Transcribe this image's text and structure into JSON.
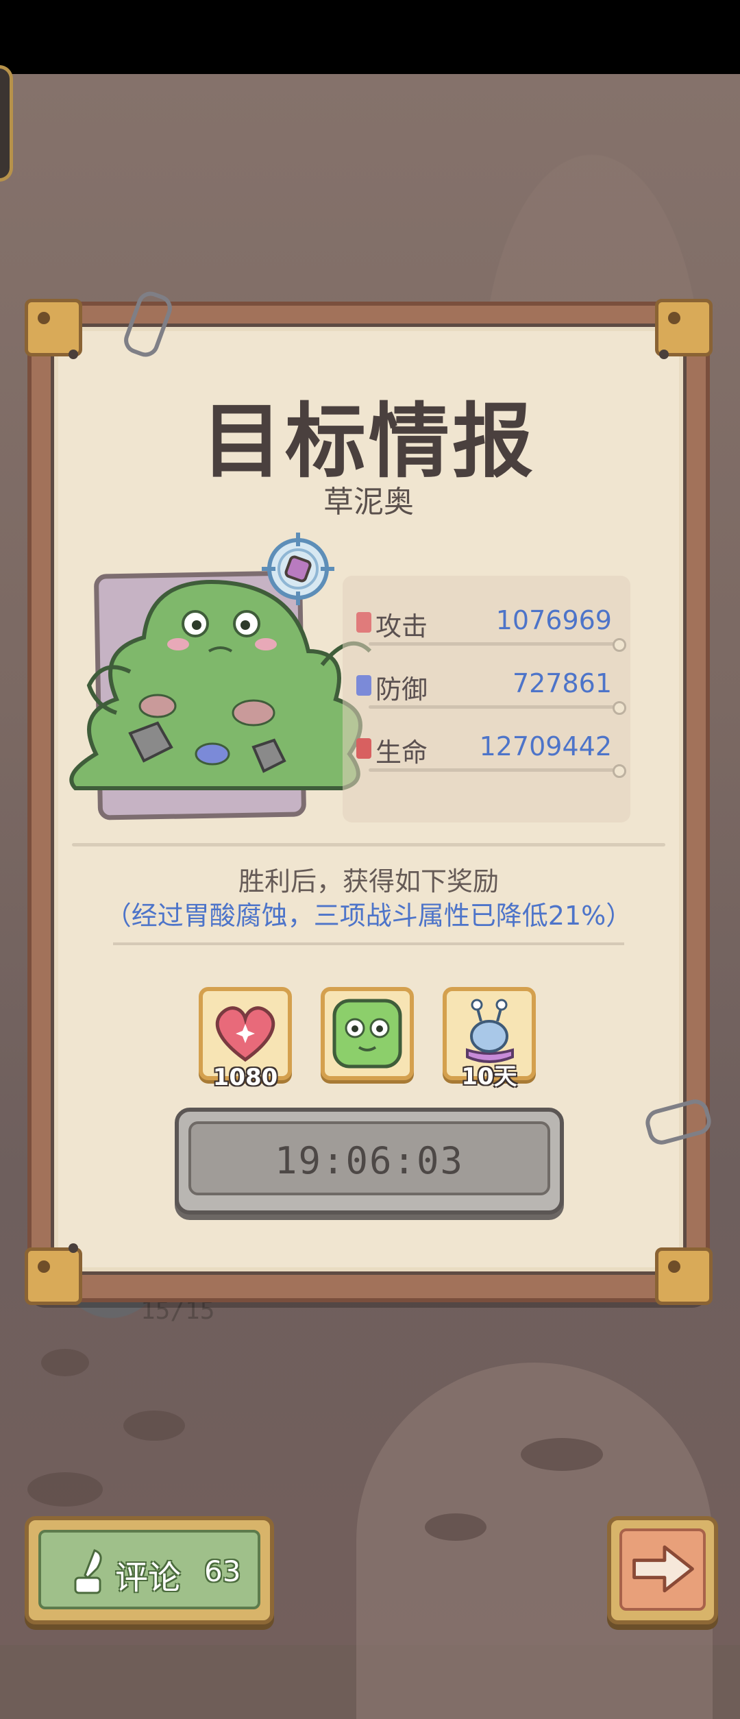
{
  "panel": {
    "title": "目标情报",
    "target_name": "草泥奥"
  },
  "stats": [
    {
      "label": "攻击",
      "value": "1076969",
      "icon": "sword-icon",
      "color": "#e07b7b"
    },
    {
      "label": "防御",
      "value": "727861",
      "icon": "shield-icon",
      "color": "#7b8ad8"
    },
    {
      "label": "生命",
      "value": "12709442",
      "icon": "health-icon",
      "color": "#d86060"
    }
  ],
  "reward": {
    "title": "胜利后，获得如下奖励",
    "note": "（经过胃酸腐蚀，三项战斗属性已降低21%）",
    "items": [
      {
        "icon": "heart-icon",
        "count": "1080"
      },
      {
        "icon": "green-slime-icon",
        "count": ""
      },
      {
        "icon": "snail-icon",
        "count": "10天"
      }
    ]
  },
  "timer": {
    "value": "19:06:03"
  },
  "background": {
    "counter": "15/15"
  },
  "footer": {
    "comment_label": "评论",
    "comment_count": "63",
    "next_icon": "arrow-right-icon"
  },
  "colors": {
    "value_blue": "#4d74c9",
    "panel_paper": "#f0e5d0",
    "frame_brown": "#a2725a",
    "corner_gold": "#d9aa58"
  }
}
